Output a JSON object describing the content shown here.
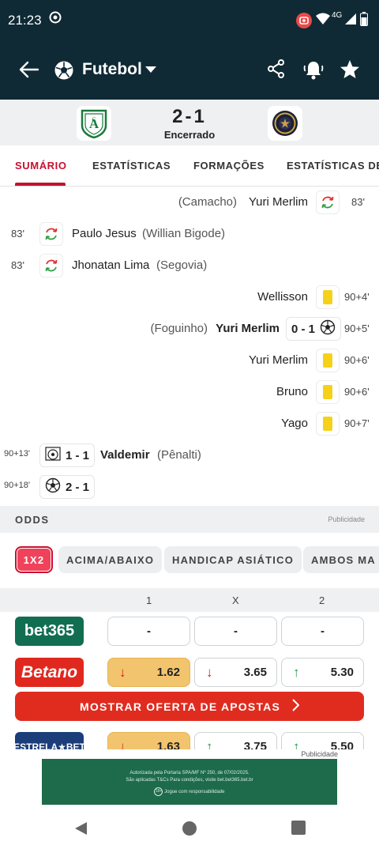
{
  "status_bar": {
    "time": "21:23",
    "network": "4G"
  },
  "app_bar": {
    "title": "Futebol",
    "icons": [
      "back-arrow-icon",
      "soccer-ball-icon",
      "dropdown-caret-icon",
      "share-icon",
      "bell-icon",
      "star-icon"
    ]
  },
  "match": {
    "score": "2-1",
    "status": "Encerrado"
  },
  "tabs": [
    "SUMÁRIO",
    "ESTATÍSTICAS",
    "FORMAÇÕES",
    "ESTATÍSTICAS DE"
  ],
  "events": [
    {
      "side": "right",
      "minute": "83'",
      "player": "Yuri Merlim",
      "sub": "(Camacho)",
      "icon": "substitution-icon"
    },
    {
      "side": "left",
      "minute": "83'",
      "player": "Paulo Jesus",
      "sub": "(Willian Bigode)",
      "icon": "substitution-icon"
    },
    {
      "side": "left",
      "minute": "83'",
      "player": "Jhonatan Lima",
      "sub": "(Segovia)",
      "icon": "substitution-icon"
    },
    {
      "side": "right",
      "minute": "90+4'",
      "player": "Wellisson",
      "icon": "yellow-card-icon"
    },
    {
      "side": "right",
      "minute": "90+5'",
      "player": "Yuri Merlim",
      "sub": "(Foguinho)",
      "score": "0 - 1",
      "icon": "goal-icon"
    },
    {
      "side": "right",
      "minute": "90+6'",
      "player": "Yuri Merlim",
      "icon": "yellow-card-icon"
    },
    {
      "side": "right",
      "minute": "90+6'",
      "player": "Bruno",
      "icon": "yellow-card-icon"
    },
    {
      "side": "right",
      "minute": "90+7'",
      "player": "Yago",
      "icon": "yellow-card-icon"
    },
    {
      "side": "left",
      "minute": "90+13'",
      "player": "Valdemir",
      "sub": "(Pênalti)",
      "score": "1 - 1",
      "icon": "penalty-goal-icon"
    },
    {
      "side": "left",
      "minute": "90+18'",
      "score": "2 - 1",
      "icon": "goal-icon"
    }
  ],
  "odds": {
    "header": "ODDS",
    "ad_label": "Publicidade",
    "markets": [
      "1X2",
      "ACIMA/ABAIXO",
      "HANDICAP ASIÁTICO",
      "AMBOS MA"
    ],
    "columns": [
      "1",
      "X",
      "2"
    ],
    "bookmakers": [
      {
        "name": "bet365",
        "color": "#126e51",
        "odds": [
          "-",
          "-",
          "-"
        ],
        "trends": [
          "",
          "",
          ""
        ]
      },
      {
        "name": "Betano",
        "color": "#e0281f",
        "odds": [
          "1.62",
          "3.65",
          "5.30"
        ],
        "trends": [
          "down",
          "down",
          "up"
        ]
      },
      {
        "name": "ESTRELA★BET",
        "color": "#1b3d7a",
        "odds": [
          "1.63",
          "3.75",
          "5.50"
        ],
        "trends": [
          "down",
          "up",
          "up"
        ]
      }
    ],
    "cta": "MOSTRAR OFERTA DE APOSTAS"
  },
  "ad": {
    "label": "Publicidade",
    "line1": "Autorizada pela Portaria SPA/MF Nº 250, de 07/02/2025.",
    "line2": "São aplicadas T&Cs Para condições, visite bet.bet365.bet.br",
    "line3": "Jogue com responsabilidade",
    "badge": "18+"
  },
  "colors": {
    "brand_dark": "#0f2a35",
    "accent": "#c8102e",
    "yellow_card": "#f5d11a"
  }
}
